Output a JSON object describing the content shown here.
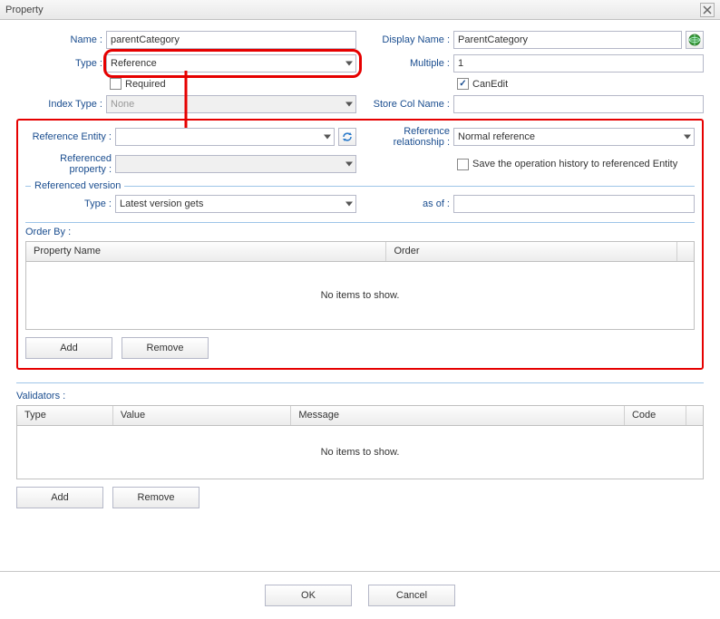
{
  "title": "Property",
  "fields": {
    "name_label": "Name :",
    "name_value": "parentCategory",
    "displayName_label": "Display Name :",
    "displayName_value": "ParentCategory",
    "type_label": "Type :",
    "type_value": "Reference",
    "multiple_label": "Multiple :",
    "multiple_value": "1",
    "required_label": "Required",
    "canEdit_label": "CanEdit",
    "indexType_label": "Index Type :",
    "indexType_value": "None",
    "storeColName_label": "Store Col Name :",
    "storeColName_value": ""
  },
  "reference": {
    "entity_label": "Reference Entity :",
    "entity_value": "",
    "relationship_label": "Reference relationship :",
    "relationship_value": "Normal reference",
    "property_label": "Referenced property :",
    "property_value": "",
    "saveHistory_label": "Save the operation history to referenced Entity",
    "version_legend": "Referenced version",
    "version_type_label": "Type :",
    "version_type_value": "Latest version gets",
    "asof_label": "as of :",
    "asof_value": ""
  },
  "orderBy": {
    "label": "Order By :",
    "columns": {
      "propName": "Property Name",
      "order": "Order"
    },
    "empty": "No items to show.",
    "addBtn": "Add",
    "removeBtn": "Remove"
  },
  "validators": {
    "label": "Validators :",
    "columns": {
      "type": "Type",
      "value": "Value",
      "message": "Message",
      "code": "Code"
    },
    "empty": "No items to show.",
    "addBtn": "Add",
    "removeBtn": "Remove"
  },
  "footer": {
    "ok": "OK",
    "cancel": "Cancel"
  },
  "icons": {
    "globe": "globe-icon",
    "refresh": "refresh-icon",
    "close": "close-icon"
  }
}
